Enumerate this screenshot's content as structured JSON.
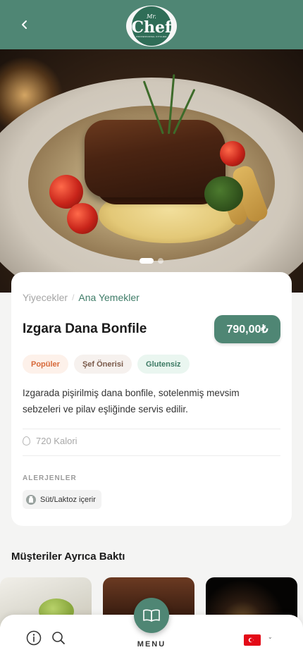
{
  "header": {
    "back_icon": "chevron-left-icon",
    "logo": {
      "top_text": "Mr.",
      "main_text": "Chef",
      "bottom_text": "PROFESSIONAL KITCHEN"
    }
  },
  "carousel": {
    "slide_count": 2,
    "active_index": 0
  },
  "product": {
    "breadcrumb": {
      "parent": "Yiyecekler",
      "separator": "/",
      "current": "Ana Yemekler"
    },
    "title": "Izgara Dana Bonfile",
    "price": "790,00₺",
    "tags": [
      {
        "label": "Popüler",
        "color": "#d7693a"
      },
      {
        "label": "Şef Önerisi",
        "color": "#7a5a4a"
      },
      {
        "label": "Glutensiz",
        "color": "#3d7a64"
      }
    ],
    "description": "Izgarada pişirilmiş dana bonfile, sotelenmiş mevsim sebzeleri ve pilav eşliğinde servis edilir.",
    "calories": "720 Kalori",
    "allergens_title": "ALERJENLER",
    "allergens": [
      {
        "label": "Süt/Laktoz içerir",
        "icon": "milk-icon"
      }
    ]
  },
  "also_viewed": {
    "title": "Müşteriler Ayrıca Baktı"
  },
  "bottom_nav": {
    "info_icon": "info-icon",
    "search_icon": "search-icon",
    "menu_icon": "book-icon",
    "menu_label": "MENU",
    "language_icon": "turkey-flag-icon"
  },
  "colors": {
    "brand": "#4f8674",
    "accent_orange": "#d7693a"
  }
}
